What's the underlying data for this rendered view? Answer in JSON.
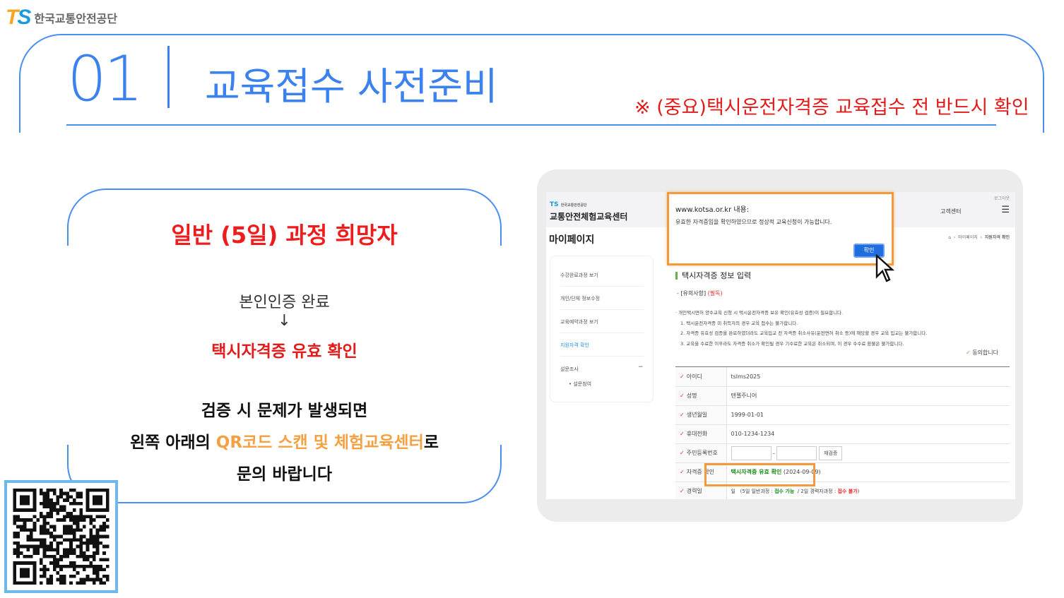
{
  "logo": {
    "mark_t": "T",
    "mark_s": "S",
    "org": "한국교통안전공단"
  },
  "header": {
    "number": "01",
    "title": "교육접수 사전준비",
    "note": "※ (중요)택시운전자격증 교육접수 전 반드시 확인"
  },
  "card": {
    "heading": "일반 (5일) 과정 희망자",
    "step1": "본인인증 완료",
    "arrow": "↓",
    "step2": "택시자격증 유효 확인",
    "line1": "검증 시 문제가 발생되면",
    "line2_a": "왼쪽 아래의 ",
    "line2_b": "QR코드 스캔 및 체험교육센터",
    "line2_c": "로",
    "line3": "문의 바랍니다"
  },
  "site": {
    "logo_ts": "TS",
    "logo_small": "한국교통안전공단",
    "center": "교통안전체험교육센터",
    "logout": "로그아웃",
    "nav_cs": "고객센터",
    "page_title": "마이페이지",
    "breadcrumb": [
      "마이페이지",
      "지원자격 확인"
    ],
    "sidebar": [
      "수강완료과정 보기",
      "개인/단체 정보수정",
      "교육예약과정 보기",
      "지원자격 확인",
      "설문조사"
    ],
    "sidebar_sub": "설문참여",
    "minus": "−",
    "section_title": "택시자격증 정보 입력",
    "notice_label": "[유의사항]",
    "notice_req": "(필독)",
    "notice_lines": [
      "· 개인택시면허 양수교육 신청 시 택시운전자격증 보유 확인(유효성 검증)이 필요합니다.",
      "1. 택시운전자격증 미 취득자의 경우 교육 접수는 불가합니다.",
      "2. 자격증 유효성 검증을 완료하였더라도 교육입교 전 자격증 취소사유(운전면허 취소 등)에 해당할 경우 교육 입교는 불가합니다.",
      "3. 교육을 수료한 이후라도 자격증 취소가 확인될 경우 기수료한 교육은 취소되며, 이 경우 수수료 환불은 불가합니다."
    ],
    "agree": "동의합니다",
    "form": {
      "id_label": "아이디",
      "id": "tslms2025",
      "name_label": "성명",
      "name": "탠젤주니어",
      "birth_label": "생년월일",
      "birth": "1999-01-01",
      "phone_label": "휴대전화",
      "phone": "010-1234-1234",
      "rrn_label": "주민등록번호",
      "dash": "-",
      "recheck": "재검증",
      "cert_label": "자격증 확인",
      "cert_status": "택시자격증 유효 확인",
      "cert_date": "(2024-09-09)",
      "career_label": "경력일",
      "career_unit": "일",
      "career_a": "(5일 일반과정 : ",
      "career_ok": "접수 가능",
      "career_b": "/ 2일 경력자과정 : ",
      "career_no": "접수 불가",
      "career_c": ")"
    },
    "dialog": {
      "origin": "www.kotsa.or.kr 내용:",
      "message": "유효한 자격증임을 확인하였으므로 정상적 교육신청이 가능합니다.",
      "ok": "확인"
    }
  },
  "colors": {
    "blue": "#3c82ef",
    "red": "#e21b1b",
    "orange": "#f5a041"
  }
}
